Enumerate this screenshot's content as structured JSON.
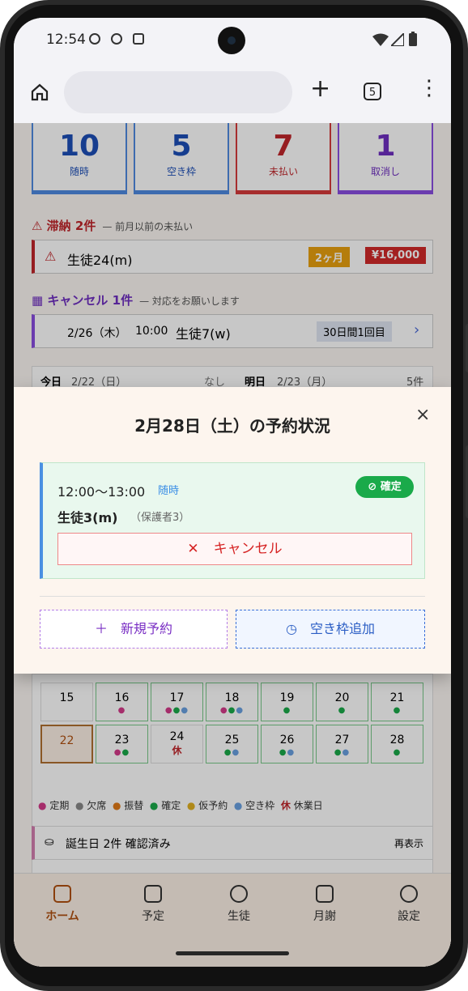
{
  "status_bar": {
    "time": "12:54"
  },
  "browser": {
    "tab_count": "5",
    "plus": "+",
    "more": "⋮"
  },
  "stats": [
    {
      "value": "10",
      "label": "随時",
      "color": "#1d4fb8"
    },
    {
      "value": "5",
      "label": "空き枠",
      "color": "#1d4fb8"
    },
    {
      "value": "7",
      "label": "未払い",
      "color": "#c0262b"
    },
    {
      "value": "1",
      "label": "取消し",
      "color": "#6f2fc0"
    }
  ],
  "overdue": {
    "title": "滞納 2件",
    "note": "— 前月以前の未払い",
    "student": "生徒24(m)",
    "months": "2ヶ月",
    "amount": "¥16,000"
  },
  "cancel_section": {
    "title": "キャンセル 1件",
    "note": "— 対応をお願いします",
    "date": "2/26（木）",
    "time": "10:00",
    "student": "生徒7(w)",
    "badge": "30日間1回目"
  },
  "today": {
    "label": "今日",
    "date": "2/22（日）",
    "count": "なし"
  },
  "tomorrow": {
    "label": "明日",
    "date": "2/23（月）",
    "count": "5件"
  },
  "calendar": {
    "week1": [
      "15",
      "16",
      "17",
      "18",
      "19",
      "20",
      "21"
    ],
    "week2": [
      "22",
      "23",
      "24",
      "25",
      "26",
      "27",
      "28"
    ],
    "holiday_mark": "休"
  },
  "legend": [
    {
      "label": "定期",
      "color": "#d43a8a"
    },
    {
      "label": "欠席",
      "color": "#888888"
    },
    {
      "label": "振替",
      "color": "#e07a18"
    },
    {
      "label": "確定",
      "color": "#1aaa4a"
    },
    {
      "label": "仮予約",
      "color": "#e0b020"
    },
    {
      "label": "空き枠",
      "color": "#6aa0e0"
    }
  ],
  "legend_holiday": {
    "mark": "休",
    "label": "休業日"
  },
  "birthday": {
    "text": "誕生日 2件 確認済み",
    "action": "再表示"
  },
  "nav": [
    "ホーム",
    "予定",
    "生徒",
    "月謝",
    "設定"
  ],
  "modal": {
    "title": "2月28日（土）の予約状況",
    "close": "×",
    "booking": {
      "time": "12:00〜13:00",
      "type": "随時",
      "status": "確定",
      "student": "生徒3(m)",
      "guardian": "（保護者3）",
      "cancel_label": "キャンセル"
    },
    "new_reservation": "新規予約",
    "add_slot": "空き枠追加"
  }
}
